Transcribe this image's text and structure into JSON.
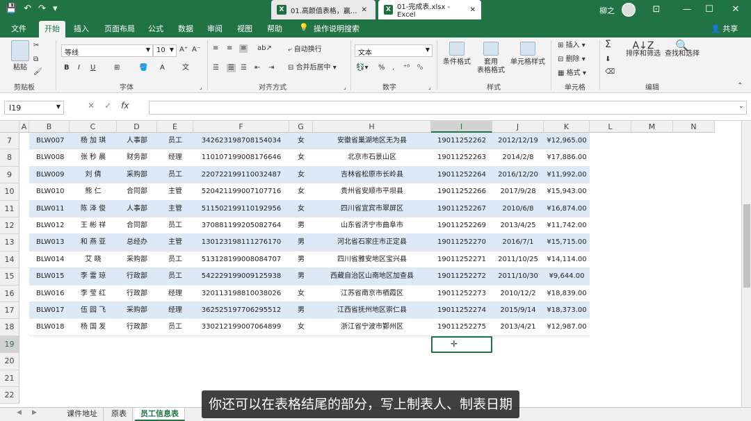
{
  "window": {
    "tab1": "01.高颜值表格，赢...",
    "tab2": "01-完成表.xlsx - Excel",
    "user": "柳之",
    "accent": "#217346"
  },
  "menu": [
    "文件",
    "开始",
    "插入",
    "页面布局",
    "公式",
    "数据",
    "审阅",
    "视图",
    "帮助",
    "操作说明搜索"
  ],
  "share": "共享",
  "ribbon": {
    "paste": "粘贴",
    "clipboard": "剪贴板",
    "font_name": "等线",
    "font_size": "10",
    "bold": "B",
    "italic": "I",
    "underline": "U",
    "font_group": "字体",
    "wrap": "自动换行",
    "merge": "合并后居中",
    "align_group": "对齐方式",
    "num_format": "文本",
    "percent": "%",
    "number_group": "数字",
    "cond_format": "条件格式",
    "table_format1": "套用",
    "table_format2": "表格格式",
    "cell_style": "单元格样式",
    "style_group": "样式",
    "insert": "插入",
    "delete": "删除",
    "format": "格式",
    "cells_group": "单元格",
    "sort": "排序和筛选",
    "find": "查找和选择",
    "edit_group": "编辑"
  },
  "namebox": "I19",
  "fx": "fx",
  "columns": [
    "A",
    "B",
    "C",
    "D",
    "E",
    "F",
    "G",
    "H",
    "I",
    "J",
    "K",
    "L",
    "M",
    "N"
  ],
  "rows": [
    {
      "n": "7",
      "c": [
        "BLW007",
        "杨 加 琪",
        "人事部",
        "员工",
        "342623198708154034",
        "女",
        "安徽省巢湖地区无为县",
        "19011252262",
        "2012/12/19",
        "¥12,965.00"
      ]
    },
    {
      "n": "8",
      "c": [
        "BLW008",
        "张 秒 晨",
        "财务部",
        "经理",
        "110107199008176646",
        "女",
        "北京市石景山区",
        "19011252263",
        "2014/2/8",
        "¥17,886.00"
      ]
    },
    {
      "n": "9",
      "c": [
        "BLW009",
        "刘    倩",
        "采购部",
        "员工",
        "220722199110032487",
        "女",
        "吉林省松原市长岭县",
        "19011252264",
        "2016/12/20",
        "¥11,992.00"
      ]
    },
    {
      "n": "10",
      "c": [
        "BLW010",
        "熊    仁",
        "合同部",
        "主管",
        "520421199007107716",
        "女",
        "贵州省安顺市平坝县",
        "19011252266",
        "2017/9/28",
        "¥15,943.00"
      ]
    },
    {
      "n": "11",
      "c": [
        "BLW011",
        "陈 泽 俊",
        "人事部",
        "主管",
        "511502199110192956",
        "女",
        "四川省宜宾市翠屏区",
        "19011252267",
        "2010/6/8",
        "¥16,874.00"
      ]
    },
    {
      "n": "12",
      "c": [
        "BLW012",
        "王 彬 祥",
        "合同部",
        "员工",
        "370881199205082764",
        "男",
        "山东省济宁市曲阜市",
        "19011252269",
        "2013/4/25",
        "¥11,742.00"
      ]
    },
    {
      "n": "13",
      "c": [
        "BLW013",
        "和 燕 亚",
        "总经办",
        "主管",
        "130123198111276170",
        "男",
        "河北省石家庄市正定县",
        "19011252270",
        "2016/7/1",
        "¥15,715.00"
      ]
    },
    {
      "n": "14",
      "c": [
        "BLW014",
        "艾    晓",
        "采购部",
        "员工",
        "513128199008084707",
        "男",
        "四川省雅安地区宝兴县",
        "19011252271",
        "2011/10/25",
        "¥14,114.00"
      ]
    },
    {
      "n": "15",
      "c": [
        "BLW015",
        "李 雷 琼",
        "行政部",
        "员工",
        "542229199009125938",
        "男",
        "西藏自治区山南地区加查县",
        "19011252272",
        "2011/10/30",
        "¥9,644.00"
      ]
    },
    {
      "n": "16",
      "c": [
        "BLW016",
        "李 莹 红",
        "行政部",
        "经理",
        "320113198810038026",
        "女",
        "江苏省南京市栖霞区",
        "19011252273",
        "2010/12/2",
        "¥18,839.00"
      ]
    },
    {
      "n": "17",
      "c": [
        "BLW017",
        "伍 园 飞",
        "采购部",
        "经理",
        "362525197706295512",
        "男",
        "江西省抚州地区崇仁县",
        "19011252274",
        "2015/9/14",
        "¥18,373.00"
      ]
    },
    {
      "n": "18",
      "c": [
        "BLW018",
        "杨 国 发",
        "行政部",
        "员工",
        "330212199007064899",
        "女",
        "浙江省宁波市鄞州区",
        "19011252275",
        "2013/4/21",
        "¥12,987.00"
      ]
    },
    {
      "n": "19",
      "c": []
    },
    {
      "n": "20",
      "c": []
    },
    {
      "n": "21",
      "c": []
    },
    {
      "n": "22",
      "c": []
    }
  ],
  "sheets": [
    "课件地址",
    "原表",
    "员工信息表"
  ],
  "subtitle": "你还可以在表格结尾的部分，写上制表人、制表日期"
}
